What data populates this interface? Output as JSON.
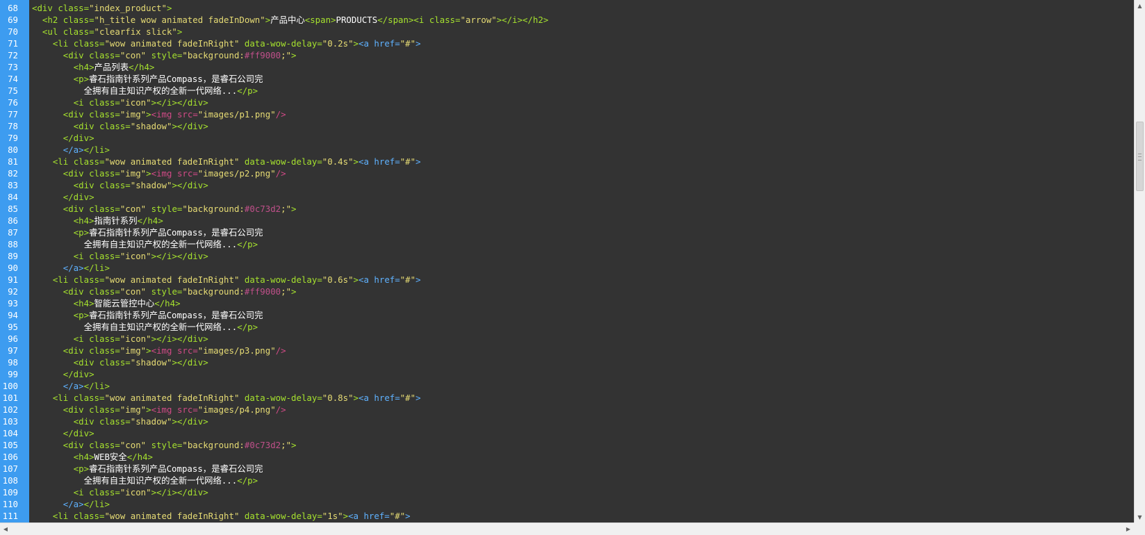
{
  "editor": {
    "lines": [
      {
        "n": "68",
        "segs": [
          [
            "p",
            ""
          ],
          [
            "t",
            "<div "
          ],
          [
            "a",
            "class="
          ],
          [
            "s",
            "\"index_product\""
          ],
          [
            "t",
            ">"
          ]
        ]
      },
      {
        "n": "69",
        "segs": [
          [
            "p",
            "  "
          ],
          [
            "t",
            "<h2 "
          ],
          [
            "a",
            "class="
          ],
          [
            "s",
            "\"h_title wow animated fadeInDown\""
          ],
          [
            "t",
            ">"
          ],
          [
            "p",
            "产品中心"
          ],
          [
            "t",
            "<span>"
          ],
          [
            "p",
            "PRODUCTS"
          ],
          [
            "t",
            "</span><i "
          ],
          [
            "a",
            "class="
          ],
          [
            "s",
            "\"arrow\""
          ],
          [
            "t",
            "></i></h2>"
          ]
        ]
      },
      {
        "n": "70",
        "segs": [
          [
            "p",
            "  "
          ],
          [
            "t",
            "<ul "
          ],
          [
            "a",
            "class="
          ],
          [
            "s",
            "\"clearfix slick\""
          ],
          [
            "t",
            ">"
          ]
        ]
      },
      {
        "n": "71",
        "segs": [
          [
            "p",
            "    "
          ],
          [
            "t",
            "<li "
          ],
          [
            "a",
            "class="
          ],
          [
            "s",
            "\"wow animated fadeInRight\""
          ],
          [
            "a",
            " data-wow-delay="
          ],
          [
            "s",
            "\"0.2s\""
          ],
          [
            "t",
            ">"
          ],
          [
            "ln",
            "<a href="
          ],
          [
            "s",
            "\"#\""
          ],
          [
            "ln",
            ">"
          ]
        ]
      },
      {
        "n": "72",
        "segs": [
          [
            "p",
            "      "
          ],
          [
            "t",
            "<div "
          ],
          [
            "a",
            "class="
          ],
          [
            "s",
            "\"con\""
          ],
          [
            "a",
            " style="
          ],
          [
            "s",
            "\"background:"
          ],
          [
            "hex",
            "#ff9000"
          ],
          [
            "s",
            ";\""
          ],
          [
            "t",
            ">"
          ]
        ]
      },
      {
        "n": "73",
        "segs": [
          [
            "p",
            "        "
          ],
          [
            "t",
            "<h4>"
          ],
          [
            "p",
            "产品列表"
          ],
          [
            "t",
            "</h4>"
          ]
        ]
      },
      {
        "n": "74",
        "segs": [
          [
            "p",
            "        "
          ],
          [
            "t",
            "<p>"
          ],
          [
            "p",
            "睿石指南针系列产品Compass，是睿石公司完"
          ]
        ]
      },
      {
        "n": "75",
        "segs": [
          [
            "p",
            "          全拥有自主知识产权的全新一代网络..."
          ],
          [
            "t",
            "</p>"
          ]
        ]
      },
      {
        "n": "76",
        "segs": [
          [
            "p",
            "        "
          ],
          [
            "t",
            "<i "
          ],
          [
            "a",
            "class="
          ],
          [
            "s",
            "\"icon\""
          ],
          [
            "t",
            "></i></div>"
          ]
        ]
      },
      {
        "n": "77",
        "segs": [
          [
            "p",
            "      "
          ],
          [
            "t",
            "<div "
          ],
          [
            "a",
            "class="
          ],
          [
            "s",
            "\"img\""
          ],
          [
            "t",
            ">"
          ],
          [
            "img",
            "<img "
          ],
          [
            "img",
            "src="
          ],
          [
            "s",
            "\"images/p1.png\""
          ],
          [
            "img",
            "/>"
          ]
        ]
      },
      {
        "n": "78",
        "segs": [
          [
            "p",
            "        "
          ],
          [
            "t",
            "<div "
          ],
          [
            "a",
            "class="
          ],
          [
            "s",
            "\"shadow\""
          ],
          [
            "t",
            "></div>"
          ]
        ]
      },
      {
        "n": "79",
        "segs": [
          [
            "p",
            "      "
          ],
          [
            "t",
            "</div>"
          ]
        ]
      },
      {
        "n": "80",
        "segs": [
          [
            "p",
            "      "
          ],
          [
            "ln",
            "</a>"
          ],
          [
            "t",
            "</li>"
          ]
        ]
      },
      {
        "n": "81",
        "segs": [
          [
            "p",
            "    "
          ],
          [
            "t",
            "<li "
          ],
          [
            "a",
            "class="
          ],
          [
            "s",
            "\"wow animated fadeInRight\""
          ],
          [
            "a",
            " data-wow-delay="
          ],
          [
            "s",
            "\"0.4s\""
          ],
          [
            "t",
            ">"
          ],
          [
            "ln",
            "<a href="
          ],
          [
            "s",
            "\"#\""
          ],
          [
            "ln",
            ">"
          ]
        ]
      },
      {
        "n": "82",
        "segs": [
          [
            "p",
            "      "
          ],
          [
            "t",
            "<div "
          ],
          [
            "a",
            "class="
          ],
          [
            "s",
            "\"img\""
          ],
          [
            "t",
            ">"
          ],
          [
            "img",
            "<img "
          ],
          [
            "img",
            "src="
          ],
          [
            "s",
            "\"images/p2.png\""
          ],
          [
            "img",
            "/>"
          ]
        ]
      },
      {
        "n": "83",
        "segs": [
          [
            "p",
            "        "
          ],
          [
            "t",
            "<div "
          ],
          [
            "a",
            "class="
          ],
          [
            "s",
            "\"shadow\""
          ],
          [
            "t",
            "></div>"
          ]
        ]
      },
      {
        "n": "84",
        "segs": [
          [
            "p",
            "      "
          ],
          [
            "t",
            "</div>"
          ]
        ]
      },
      {
        "n": "85",
        "segs": [
          [
            "p",
            "      "
          ],
          [
            "t",
            "<div "
          ],
          [
            "a",
            "class="
          ],
          [
            "s",
            "\"con\""
          ],
          [
            "a",
            " style="
          ],
          [
            "s",
            "\"background:"
          ],
          [
            "hex",
            "#0c73d2"
          ],
          [
            "s",
            ";\""
          ],
          [
            "t",
            ">"
          ]
        ]
      },
      {
        "n": "86",
        "segs": [
          [
            "p",
            "        "
          ],
          [
            "t",
            "<h4>"
          ],
          [
            "p",
            "指南针系列"
          ],
          [
            "t",
            "</h4>"
          ]
        ]
      },
      {
        "n": "87",
        "segs": [
          [
            "p",
            "        "
          ],
          [
            "t",
            "<p>"
          ],
          [
            "p",
            "睿石指南针系列产品Compass，是睿石公司完"
          ]
        ]
      },
      {
        "n": "88",
        "segs": [
          [
            "p",
            "          全拥有自主知识产权的全新一代网络..."
          ],
          [
            "t",
            "</p>"
          ]
        ]
      },
      {
        "n": "89",
        "segs": [
          [
            "p",
            "        "
          ],
          [
            "t",
            "<i "
          ],
          [
            "a",
            "class="
          ],
          [
            "s",
            "\"icon\""
          ],
          [
            "t",
            "></i></div>"
          ]
        ]
      },
      {
        "n": "90",
        "segs": [
          [
            "p",
            "      "
          ],
          [
            "ln",
            "</a>"
          ],
          [
            "t",
            "</li>"
          ]
        ]
      },
      {
        "n": "91",
        "segs": [
          [
            "p",
            "    "
          ],
          [
            "t",
            "<li "
          ],
          [
            "a",
            "class="
          ],
          [
            "s",
            "\"wow animated fadeInRight\""
          ],
          [
            "a",
            " data-wow-delay="
          ],
          [
            "s",
            "\"0.6s\""
          ],
          [
            "t",
            ">"
          ],
          [
            "ln",
            "<a href="
          ],
          [
            "s",
            "\"#\""
          ],
          [
            "ln",
            ">"
          ]
        ]
      },
      {
        "n": "92",
        "segs": [
          [
            "p",
            "      "
          ],
          [
            "t",
            "<div "
          ],
          [
            "a",
            "class="
          ],
          [
            "s",
            "\"con\""
          ],
          [
            "a",
            " style="
          ],
          [
            "s",
            "\"background:"
          ],
          [
            "hex",
            "#ff9000"
          ],
          [
            "s",
            ";\""
          ],
          [
            "t",
            ">"
          ]
        ]
      },
      {
        "n": "93",
        "segs": [
          [
            "p",
            "        "
          ],
          [
            "t",
            "<h4>"
          ],
          [
            "p",
            "智能云管控中心"
          ],
          [
            "t",
            "</h4>"
          ]
        ]
      },
      {
        "n": "94",
        "segs": [
          [
            "p",
            "        "
          ],
          [
            "t",
            "<p>"
          ],
          [
            "p",
            "睿石指南针系列产品Compass，是睿石公司完"
          ]
        ]
      },
      {
        "n": "95",
        "segs": [
          [
            "p",
            "          全拥有自主知识产权的全新一代网络..."
          ],
          [
            "t",
            "</p>"
          ]
        ]
      },
      {
        "n": "96",
        "segs": [
          [
            "p",
            "        "
          ],
          [
            "t",
            "<i "
          ],
          [
            "a",
            "class="
          ],
          [
            "s",
            "\"icon\""
          ],
          [
            "t",
            "></i></div>"
          ]
        ]
      },
      {
        "n": "97",
        "segs": [
          [
            "p",
            "      "
          ],
          [
            "t",
            "<div "
          ],
          [
            "a",
            "class="
          ],
          [
            "s",
            "\"img\""
          ],
          [
            "t",
            ">"
          ],
          [
            "img",
            "<img "
          ],
          [
            "img",
            "src="
          ],
          [
            "s",
            "\"images/p3.png\""
          ],
          [
            "img",
            "/>"
          ]
        ]
      },
      {
        "n": "98",
        "segs": [
          [
            "p",
            "        "
          ],
          [
            "t",
            "<div "
          ],
          [
            "a",
            "class="
          ],
          [
            "s",
            "\"shadow\""
          ],
          [
            "t",
            "></div>"
          ]
        ]
      },
      {
        "n": "99",
        "segs": [
          [
            "p",
            "      "
          ],
          [
            "t",
            "</div>"
          ]
        ]
      },
      {
        "n": "100",
        "segs": [
          [
            "p",
            "      "
          ],
          [
            "ln",
            "</a>"
          ],
          [
            "t",
            "</li>"
          ]
        ]
      },
      {
        "n": "101",
        "segs": [
          [
            "p",
            "    "
          ],
          [
            "t",
            "<li "
          ],
          [
            "a",
            "class="
          ],
          [
            "s",
            "\"wow animated fadeInRight\""
          ],
          [
            "a",
            " data-wow-delay="
          ],
          [
            "s",
            "\"0.8s\""
          ],
          [
            "t",
            ">"
          ],
          [
            "ln",
            "<a href="
          ],
          [
            "s",
            "\"#\""
          ],
          [
            "ln",
            ">"
          ]
        ]
      },
      {
        "n": "102",
        "segs": [
          [
            "p",
            "      "
          ],
          [
            "t",
            "<div "
          ],
          [
            "a",
            "class="
          ],
          [
            "s",
            "\"img\""
          ],
          [
            "t",
            ">"
          ],
          [
            "img",
            "<img "
          ],
          [
            "img",
            "src="
          ],
          [
            "s",
            "\"images/p4.png\""
          ],
          [
            "img",
            "/>"
          ]
        ]
      },
      {
        "n": "103",
        "segs": [
          [
            "p",
            "        "
          ],
          [
            "t",
            "<div "
          ],
          [
            "a",
            "class="
          ],
          [
            "s",
            "\"shadow\""
          ],
          [
            "t",
            "></div>"
          ]
        ]
      },
      {
        "n": "104",
        "segs": [
          [
            "p",
            "      "
          ],
          [
            "t",
            "</div>"
          ]
        ]
      },
      {
        "n": "105",
        "segs": [
          [
            "p",
            "      "
          ],
          [
            "t",
            "<div "
          ],
          [
            "a",
            "class="
          ],
          [
            "s",
            "\"con\""
          ],
          [
            "a",
            " style="
          ],
          [
            "s",
            "\"background:"
          ],
          [
            "hex",
            "#0c73d2"
          ],
          [
            "s",
            ";\""
          ],
          [
            "t",
            ">"
          ]
        ]
      },
      {
        "n": "106",
        "segs": [
          [
            "p",
            "        "
          ],
          [
            "t",
            "<h4>"
          ],
          [
            "p",
            "WEB安全"
          ],
          [
            "t",
            "</h4>"
          ]
        ]
      },
      {
        "n": "107",
        "segs": [
          [
            "p",
            "        "
          ],
          [
            "t",
            "<p>"
          ],
          [
            "p",
            "睿石指南针系列产品Compass，是睿石公司完"
          ]
        ]
      },
      {
        "n": "108",
        "segs": [
          [
            "p",
            "          全拥有自主知识产权的全新一代网络..."
          ],
          [
            "t",
            "</p>"
          ]
        ]
      },
      {
        "n": "109",
        "segs": [
          [
            "p",
            "        "
          ],
          [
            "t",
            "<i "
          ],
          [
            "a",
            "class="
          ],
          [
            "s",
            "\"icon\""
          ],
          [
            "t",
            "></i></div>"
          ]
        ]
      },
      {
        "n": "110",
        "segs": [
          [
            "p",
            "      "
          ],
          [
            "ln",
            "</a>"
          ],
          [
            "t",
            "</li>"
          ]
        ]
      },
      {
        "n": "111",
        "segs": [
          [
            "p",
            "    "
          ],
          [
            "t",
            "<li "
          ],
          [
            "a",
            "class="
          ],
          [
            "s",
            "\"wow animated fadeInRight\""
          ],
          [
            "a",
            " data-wow-delay="
          ],
          [
            "s",
            "\"1s\""
          ],
          [
            "t",
            ">"
          ],
          [
            "ln",
            "<a href="
          ],
          [
            "s",
            "\"#\""
          ],
          [
            "ln",
            ">"
          ]
        ]
      }
    ]
  },
  "colors": {
    "background": "#333333",
    "gutter": "#3d9cf0",
    "tag": "#a6e22e",
    "string": "#e6db74",
    "img_tag": "#d14a86",
    "link_tag": "#5fb2ff",
    "hex_value": "#c0508a"
  },
  "scrollbars": {
    "up_icon": "▲",
    "down_icon": "▼",
    "left_icon": "◀",
    "right_icon": "▶"
  }
}
